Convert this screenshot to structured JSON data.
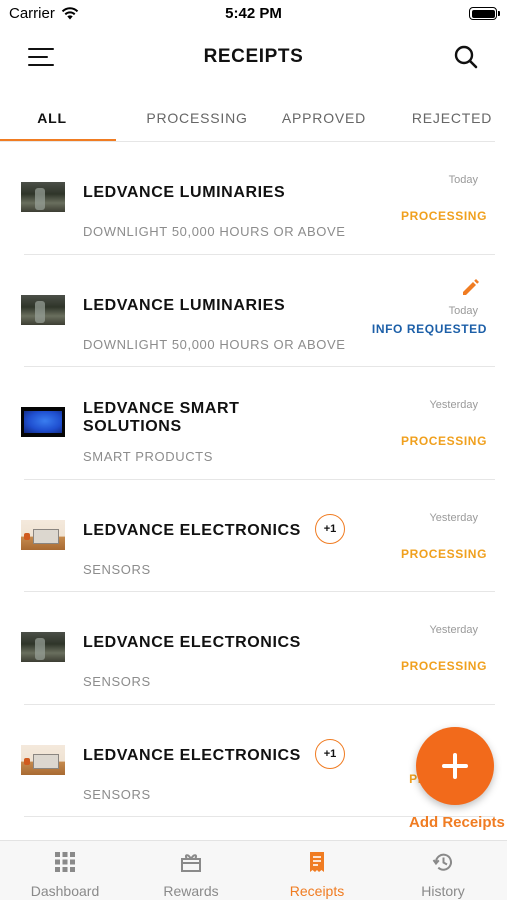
{
  "status_bar": {
    "carrier": "Carrier",
    "time": "5:42 PM"
  },
  "header": {
    "title": "RECEIPTS",
    "menu_icon": "hamburger-menu-icon",
    "search_icon": "search-icon"
  },
  "tabs": [
    {
      "label": "ALL",
      "active": true
    },
    {
      "label": "PROCESSING",
      "active": false
    },
    {
      "label": "APPROVED",
      "active": false
    },
    {
      "label": "REJECTED",
      "active": false
    }
  ],
  "receipts": [
    {
      "company": "LEDVANCE LUMINARIES",
      "category": "DOWNLIGHT 50,000 HOURS OR ABOVE",
      "date": "Today",
      "status": "PROCESSING",
      "thumbnail": "landscape"
    },
    {
      "company": "LEDVANCE LUMINARIES",
      "category": "DOWNLIGHT 50,000 HOURS OR ABOVE",
      "date": "Today",
      "status": "INFO REQUESTED",
      "thumbnail": "landscape",
      "edit_icon": "pencil-icon"
    },
    {
      "company_line1": "LEDVANCE SMART",
      "company_line2": "SOLUTIONS",
      "category": "SMART PRODUCTS",
      "date": "Yesterday",
      "status": "PROCESSING",
      "thumbnail": "screen"
    },
    {
      "company": "LEDVANCE ELECTRONICS",
      "category": "SENSORS",
      "date": "Yesterday",
      "status": "PROCESSING",
      "thumbnail": "desk",
      "badge": "+1"
    },
    {
      "company": "LEDVANCE ELECTRONICS",
      "category": "SENSORS",
      "date": "Yesterday",
      "status": "PROCESSING",
      "thumbnail": "landscape"
    },
    {
      "company": "LEDVANCE ELECTRONICS",
      "category": "SENSORS",
      "date": "",
      "status": "PR",
      "thumbnail": "desk",
      "badge": "+1"
    }
  ],
  "fab": {
    "label": "Add Receipts",
    "icon": "plus-icon"
  },
  "bottom_nav": [
    {
      "label": "Dashboard",
      "icon": "grid-icon",
      "active": false
    },
    {
      "label": "Rewards",
      "icon": "gift-icon",
      "active": false
    },
    {
      "label": "Receipts",
      "icon": "receipt-icon",
      "active": true
    },
    {
      "label": "History",
      "icon": "history-icon",
      "active": false
    }
  ],
  "colors": {
    "accent": "#f07c22",
    "status_processing": "#f0a01e",
    "status_info": "#1c5fa8",
    "fab": "#f26a1b"
  }
}
